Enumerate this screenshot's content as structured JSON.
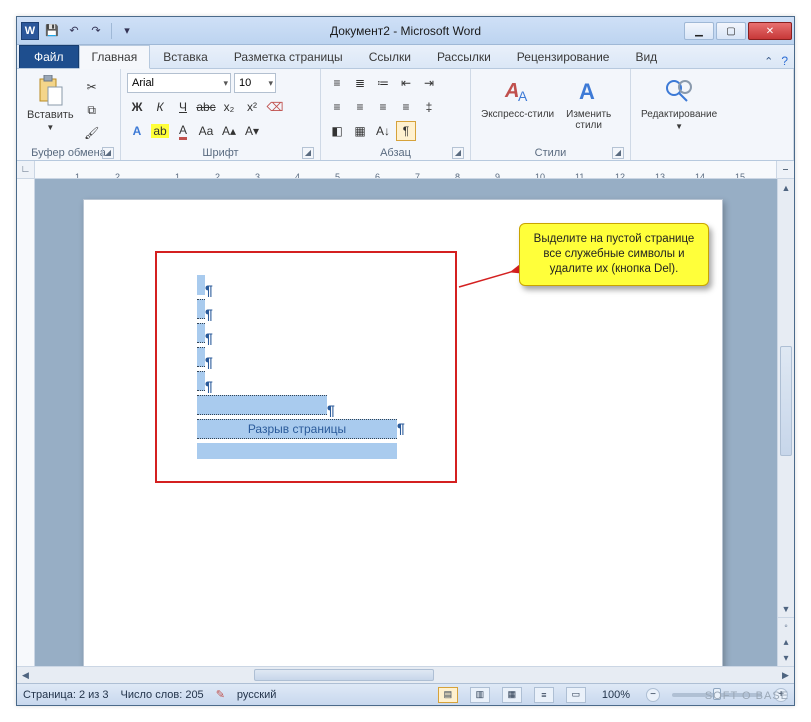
{
  "title": "Документ2 - Microsoft Word",
  "qat": {
    "save": "💾",
    "undo": "↶",
    "redo": "↷",
    "more": "▾"
  },
  "file_tab": "Файл",
  "tabs": [
    "Главная",
    "Вставка",
    "Разметка страницы",
    "Ссылки",
    "Рассылки",
    "Рецензирование",
    "Вид"
  ],
  "active_tab": 0,
  "ribbon": {
    "clipboard": {
      "label": "Буфер обмена",
      "paste": "Вставить"
    },
    "font": {
      "label": "Шрифт",
      "name": "Arial",
      "size": "10"
    },
    "paragraph": {
      "label": "Абзац"
    },
    "styles": {
      "label": "Стили",
      "quick": "Экспресс-стили",
      "change": "Изменить\nстили"
    },
    "editing": {
      "label": "Редактирование"
    }
  },
  "ruler_numbers": [
    "1",
    "2",
    "1",
    "2",
    "3",
    "4",
    "5",
    "6",
    "7",
    "8",
    "9",
    "10",
    "11",
    "12",
    "13",
    "14",
    "15"
  ],
  "callout_text": "Выделите на пустой странице все служебные символы и удалите их (кнопка Del).",
  "page_break_text": "Разрыв страницы",
  "status": {
    "page": "Страница: 2 из 3",
    "words": "Число слов: 205",
    "lang": "русский",
    "zoom": "100%"
  },
  "watermark": "SOFT O BASE"
}
